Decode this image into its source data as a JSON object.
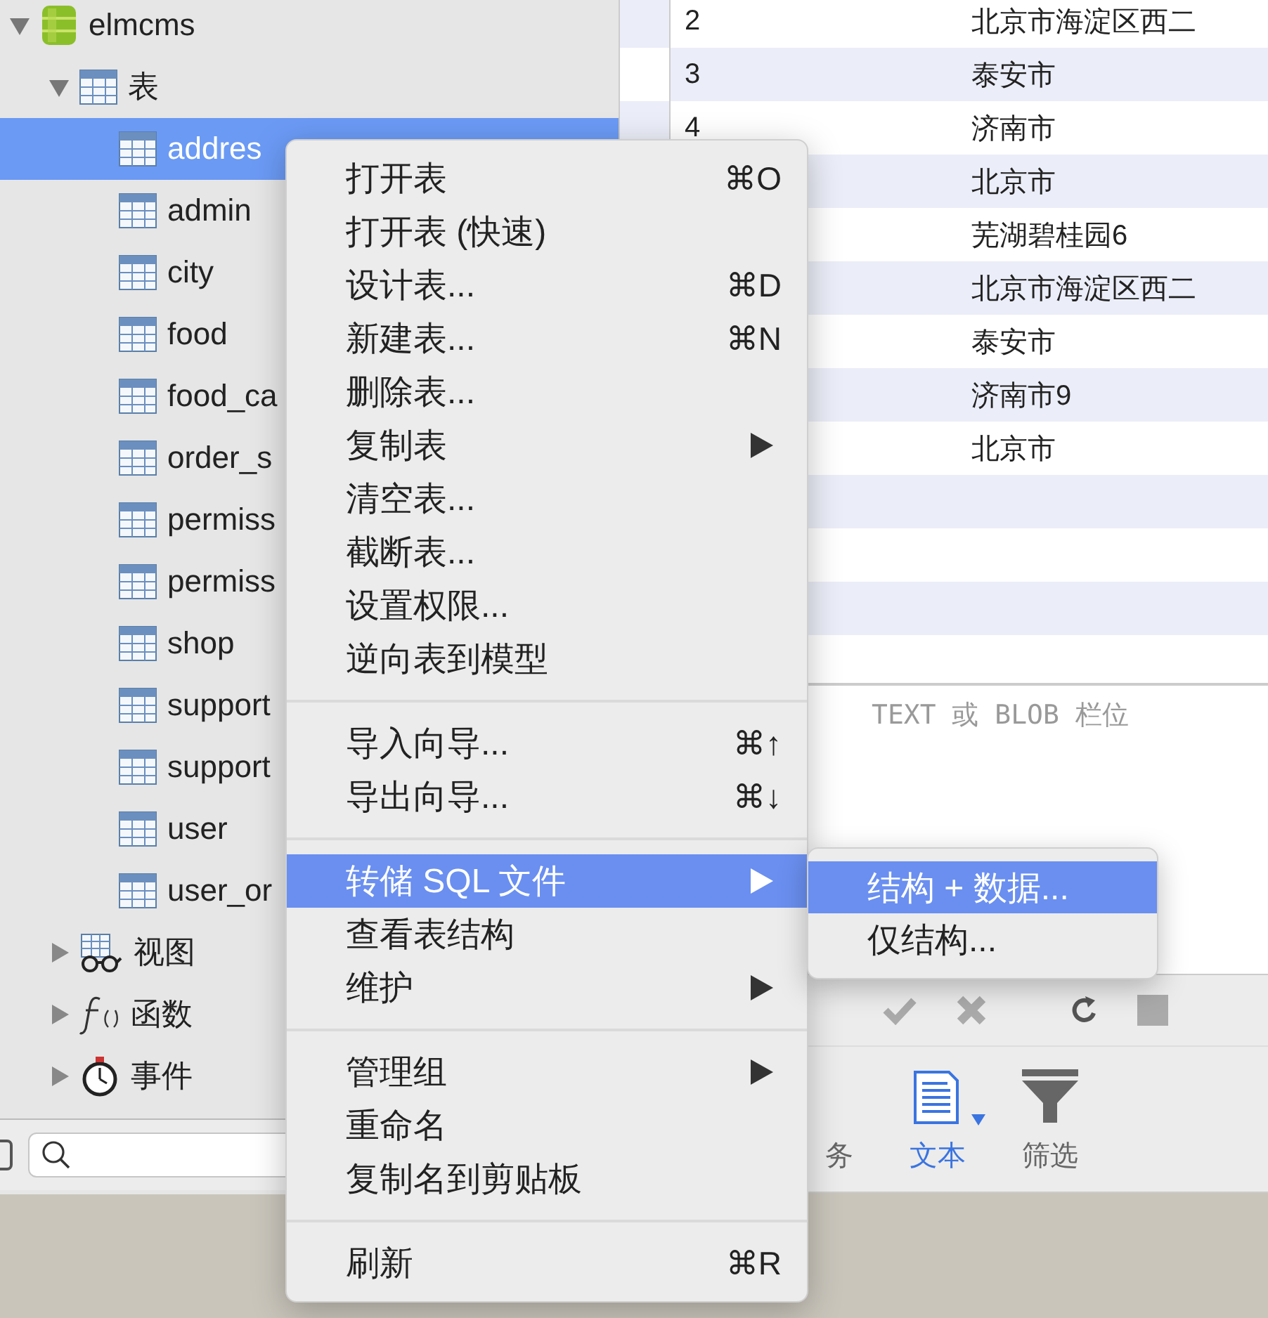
{
  "sidebar": {
    "tree": [
      {
        "label": "elmcms",
        "kind": "database",
        "expanded": true,
        "children": [
          {
            "label": "表",
            "kind": "tables",
            "expanded": true,
            "children": [
              {
                "label": "addres",
                "kind": "table",
                "selected": true
              },
              {
                "label": "admin",
                "kind": "table",
                "selected": false
              },
              {
                "label": "city",
                "kind": "table",
                "selected": false
              },
              {
                "label": "food",
                "kind": "table",
                "selected": false
              },
              {
                "label": "food_ca",
                "kind": "table",
                "selected": false
              },
              {
                "label": "order_s",
                "kind": "table",
                "selected": false
              },
              {
                "label": "permiss",
                "kind": "table",
                "selected": false
              },
              {
                "label": "permiss",
                "kind": "table",
                "selected": false
              },
              {
                "label": "shop",
                "kind": "table",
                "selected": false
              },
              {
                "label": "support",
                "kind": "table",
                "selected": false
              },
              {
                "label": "support",
                "kind": "table",
                "selected": false
              },
              {
                "label": "user",
                "kind": "table",
                "selected": false
              },
              {
                "label": "user_or",
                "kind": "table",
                "selected": false
              }
            ]
          },
          {
            "label": "视图",
            "kind": "views",
            "expanded": false
          },
          {
            "label": "函数",
            "kind": "functions",
            "expanded": false
          },
          {
            "label": "事件",
            "kind": "events",
            "expanded": false
          }
        ]
      }
    ]
  },
  "table": {
    "rows": [
      {
        "column_1": "2",
        "column_2": "北京市海淀区西二"
      },
      {
        "column_1": "3",
        "column_2": "泰安市"
      },
      {
        "column_1": "4",
        "column_2": "济南市"
      },
      {
        "column_2": "北京市"
      },
      {
        "column_2": "芜湖碧桂园6"
      },
      {
        "column_2": "北京市海淀区西二"
      },
      {
        "column_2": "泰安市"
      },
      {
        "column_2": "济南市9"
      },
      {
        "column_2": "北京市"
      }
    ]
  },
  "blob_note": "TEXT 或 BLOB 栏位",
  "toolbar": [
    {
      "label": "务",
      "kind": "transaction",
      "selected": false
    },
    {
      "label": "文本",
      "kind": "text",
      "selected": true
    },
    {
      "label": "筛选",
      "kind": "filter",
      "selected": false
    }
  ],
  "context_menu": {
    "items": [
      {
        "kind": "item",
        "label": "打开表",
        "shortcut": "⌘O",
        "submenu": false,
        "selected": false
      },
      {
        "kind": "item",
        "label": "打开表 (快速)",
        "submenu": false,
        "selected": false
      },
      {
        "kind": "item",
        "label": "设计表...",
        "shortcut": "⌘D",
        "submenu": false,
        "selected": false
      },
      {
        "kind": "item",
        "label": "新建表...",
        "shortcut": "⌘N",
        "submenu": false,
        "selected": false
      },
      {
        "kind": "item",
        "label": "删除表...",
        "submenu": false,
        "selected": false
      },
      {
        "kind": "item",
        "label": "复制表",
        "submenu": true,
        "selected": false
      },
      {
        "kind": "item",
        "label": "清空表...",
        "submenu": false,
        "selected": false
      },
      {
        "kind": "item",
        "label": "截断表...",
        "submenu": false,
        "selected": false
      },
      {
        "kind": "item",
        "label": "设置权限...",
        "submenu": false,
        "selected": false
      },
      {
        "kind": "item",
        "label": "逆向表到模型",
        "submenu": false,
        "selected": false
      },
      {
        "kind": "separator"
      },
      {
        "kind": "item",
        "label": "导入向导...",
        "shortcut": "⌘↑",
        "submenu": false,
        "selected": false
      },
      {
        "kind": "item",
        "label": "导出向导...",
        "shortcut": "⌘↓",
        "submenu": false,
        "selected": false
      },
      {
        "kind": "separator"
      },
      {
        "kind": "item",
        "label": "转储 SQL 文件",
        "submenu": true,
        "selected": true
      },
      {
        "kind": "item",
        "label": "查看表结构",
        "submenu": false,
        "selected": false
      },
      {
        "kind": "item",
        "label": "维护",
        "submenu": true,
        "selected": false
      },
      {
        "kind": "separator"
      },
      {
        "kind": "item",
        "label": "管理组",
        "submenu": true,
        "selected": false
      },
      {
        "kind": "item",
        "label": "重命名",
        "submenu": false,
        "selected": false
      },
      {
        "kind": "item",
        "label": "复制名到剪贴板",
        "submenu": false,
        "selected": false
      },
      {
        "kind": "separator"
      },
      {
        "kind": "item",
        "label": "刷新",
        "shortcut": "⌘R",
        "submenu": false,
        "selected": false
      }
    ]
  },
  "submenu": {
    "items": [
      {
        "label": "结构 + 数据...",
        "selected": true
      },
      {
        "label": "仅结构...",
        "selected": false
      }
    ]
  }
}
